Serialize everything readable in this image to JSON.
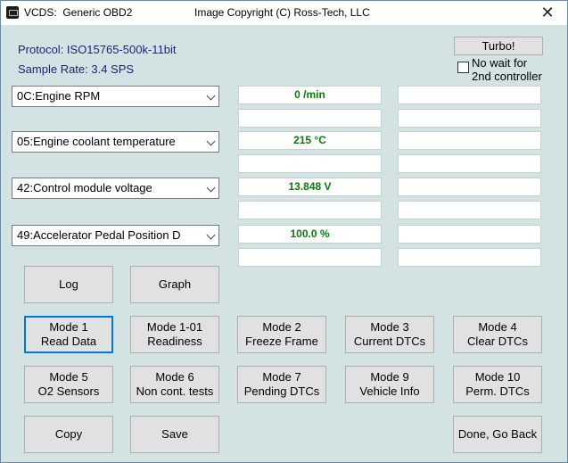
{
  "window": {
    "title_app": "VCDS:  Generic OBD2",
    "title_copyright": "Image Copyright (C) Ross-Tech, LLC",
    "close_glyph": "✕"
  },
  "info": {
    "protocol": "Protocol: ISO15765-500k-11bit",
    "sample_rate": "Sample Rate: 3.4 SPS"
  },
  "turbo": {
    "label": "Turbo!",
    "no_wait_line1": "No wait for",
    "no_wait_line2": "2nd controller",
    "no_wait_checked": false
  },
  "channels": [
    {
      "selection": "0C:Engine RPM",
      "value": "0 /min",
      "value2": "",
      "aux1": "",
      "aux2": ""
    },
    {
      "selection": "05:Engine coolant temperature",
      "value": "215 °C",
      "value2": "",
      "aux1": "",
      "aux2": ""
    },
    {
      "selection": "42:Control module voltage",
      "value": "13.848 V",
      "value2": "",
      "aux1": "",
      "aux2": ""
    },
    {
      "selection": "49:Accelerator Pedal Position D",
      "value": "100.0 %",
      "value2": "",
      "aux1": "",
      "aux2": ""
    }
  ],
  "actions": {
    "log": "Log",
    "graph": "Graph"
  },
  "modes": [
    {
      "line1": "Mode 1",
      "line2": "Read Data"
    },
    {
      "line1": "Mode 1-01",
      "line2": "Readiness"
    },
    {
      "line1": "Mode 2",
      "line2": "Freeze Frame"
    },
    {
      "line1": "Mode 3",
      "line2": "Current DTCs"
    },
    {
      "line1": "Mode 4",
      "line2": "Clear DTCs"
    },
    {
      "line1": "Mode 5",
      "line2": "O2 Sensors"
    },
    {
      "line1": "Mode 6",
      "line2": "Non cont. tests"
    },
    {
      "line1": "Mode 7",
      "line2": "Pending DTCs"
    },
    {
      "line1": "Mode 9",
      "line2": "Vehicle Info"
    },
    {
      "line1": "Mode 10",
      "line2": "Perm. DTCs"
    }
  ],
  "footer": {
    "copy": "Copy",
    "save": "Save",
    "done": "Done, Go Back"
  },
  "colors": {
    "window_bg": "#d3e3e3",
    "label_blue": "#1a237e",
    "value_green": "#0a7a0a",
    "focus_blue": "#0078d7"
  }
}
